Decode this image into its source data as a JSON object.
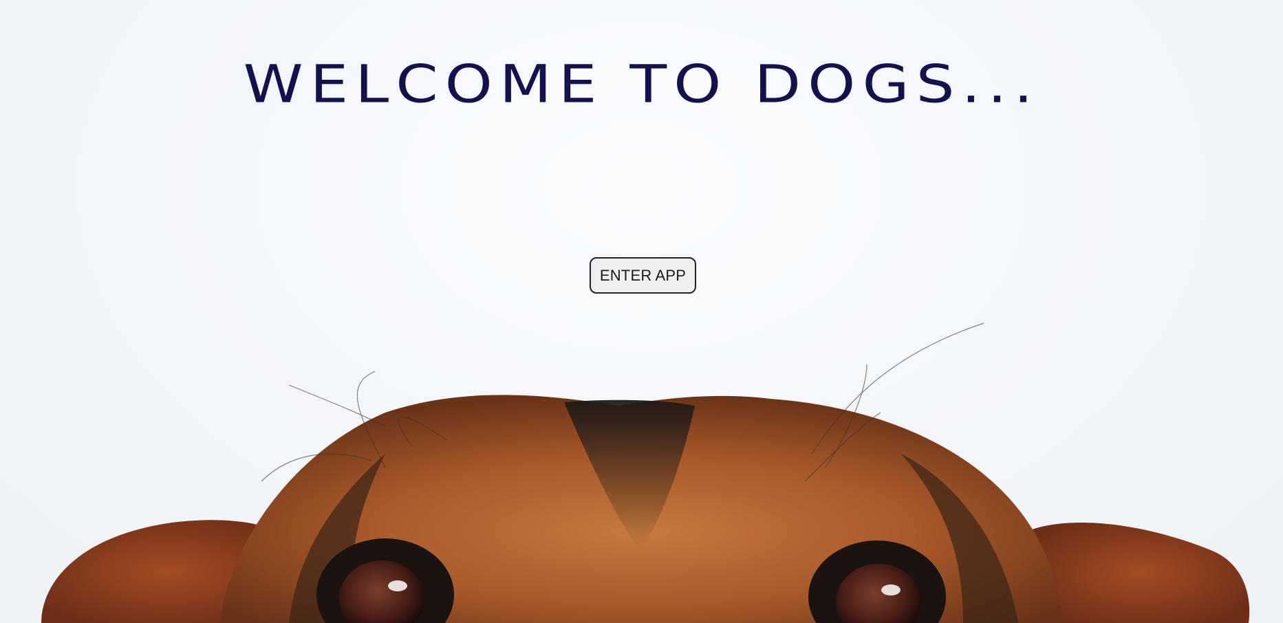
{
  "hero": {
    "title": "WELCOME TO DOGS...",
    "image_description_icon": "dog-peeking-icon"
  },
  "actions": {
    "enter_label": "ENTER APP"
  },
  "colors": {
    "title": "#13124f",
    "background": "#f3f6f9",
    "fur_tan": "#b5632a",
    "fur_dark": "#2b201b",
    "button_bg": "#efefef"
  }
}
